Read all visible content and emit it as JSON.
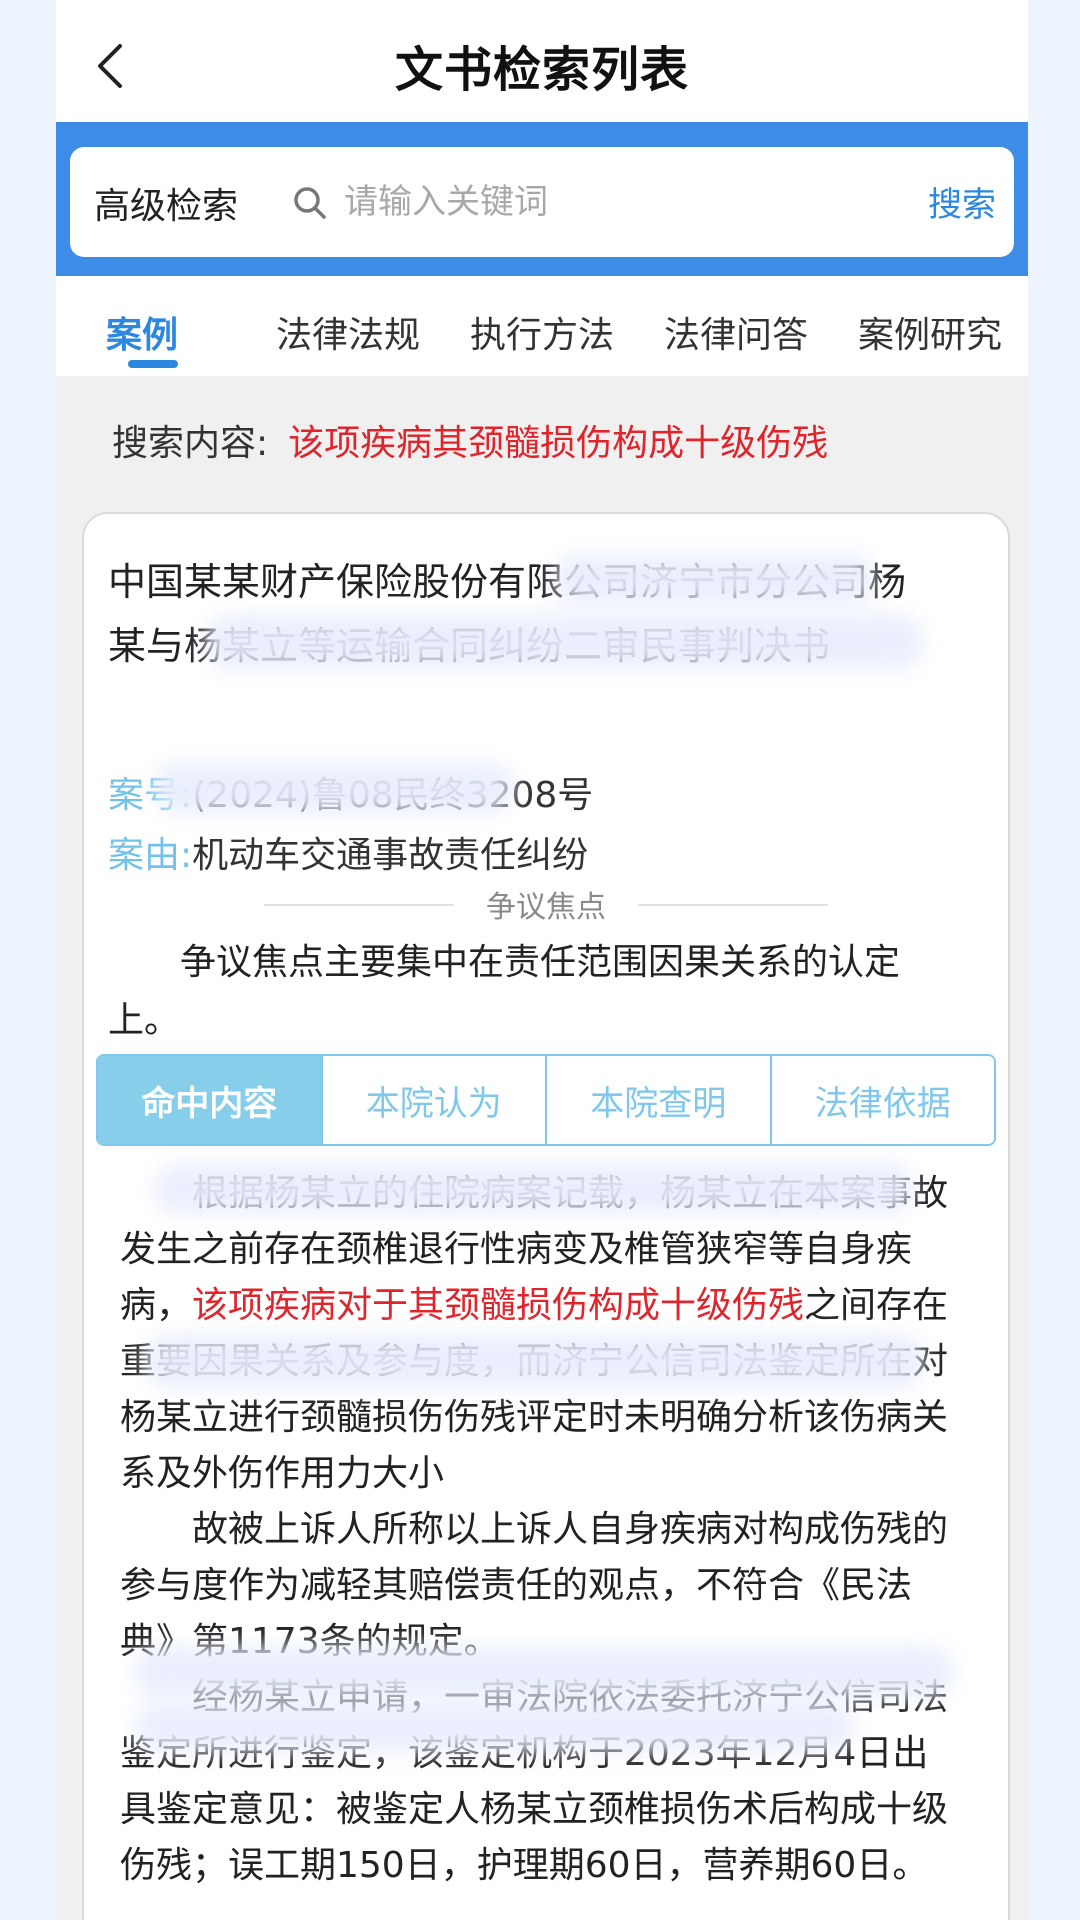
{
  "header": {
    "title": "文书检索列表"
  },
  "search": {
    "advanced_label": "高级检索",
    "placeholder": "请输入关键词",
    "value": "",
    "button_label": "搜索"
  },
  "tabs": [
    {
      "label": "案例",
      "active": true
    },
    {
      "label": "法律法规",
      "active": false
    },
    {
      "label": "执行方法",
      "active": false
    },
    {
      "label": "法律问答",
      "active": false
    },
    {
      "label": "案例研究",
      "active": false
    }
  ],
  "search_content": {
    "label": "搜索内容:",
    "value": "该项疾病其颈髓损伤构成十级伤残"
  },
  "card": {
    "title": "中国某某财产保险股份有限公司济宁市分公司杨某与杨某立等运输合同纠纷二审民事判决书",
    "case_no_label": "案号:",
    "case_no": "(2024)鲁08民终3208号",
    "cause_label": "案由:",
    "cause": "机动车交通事故责任纠纷",
    "focus_heading": "争议焦点",
    "focus_text": "争议焦点主要集中在责任范围因果关系的认定上。",
    "segments": [
      {
        "label": "命中内容",
        "active": true
      },
      {
        "label": "本院认为",
        "active": false
      },
      {
        "label": "本院查明",
        "active": false
      },
      {
        "label": "法律依据",
        "active": false
      }
    ],
    "hit_content": {
      "p1_before": "根据杨某立的住院病案记载，杨某立在本案事故发生之前存在颈椎退行性病变及椎管狭窄等自身疾病，",
      "p1_highlight": "该项疾病对于其颈髓损伤构成十级伤残",
      "p1_after": "之间存在重要因果关系及参与度，而济宁公信司法鉴定所在对杨某立进行颈髓损伤伤残评定时未明确分析该伤病关系及外伤作用力大小",
      "p2": "故被上诉人所称以上诉人自身疾病对构成伤残的参与度作为减轻其赔偿责任的观点，不符合《民法典》第1173条的规定。",
      "p3": "经杨某立申请，一审法院依法委托济宁公信司法鉴定所进行鉴定，该鉴定机构于2023年12月4日出具鉴定意见：被鉴定人杨某立颈椎损伤术后构成十级伤残；误工期150日，护理期60日，营养期60日。"
    }
  },
  "colors": {
    "accent": "#2b87e0",
    "search_band": "#3d8ce6",
    "highlight": "#e0242b",
    "segment": "#87ceeb",
    "meta_label": "#74c2e8"
  }
}
